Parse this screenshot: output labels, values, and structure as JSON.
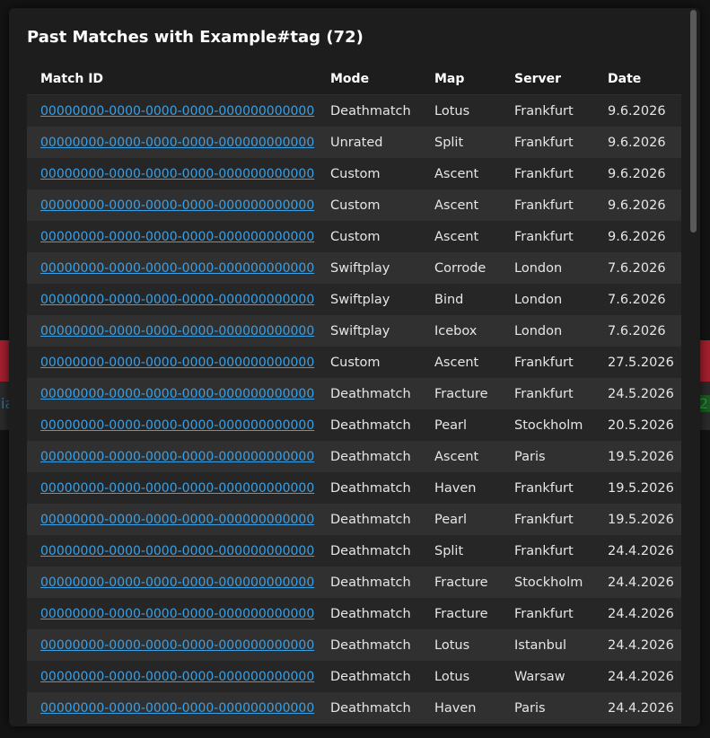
{
  "modal": {
    "title": "Past Matches with Example#tag (72)"
  },
  "table": {
    "headers": {
      "match_id": "Match ID",
      "mode": "Mode",
      "map": "Map",
      "server": "Server",
      "date": "Date"
    },
    "rows": [
      {
        "id": "00000000-0000-0000-0000-000000000000",
        "mode": "Deathmatch",
        "map": "Lotus",
        "server": "Frankfurt",
        "date": "9.6.2026"
      },
      {
        "id": "00000000-0000-0000-0000-000000000000",
        "mode": "Unrated",
        "map": "Split",
        "server": "Frankfurt",
        "date": "9.6.2026"
      },
      {
        "id": "00000000-0000-0000-0000-000000000000",
        "mode": "Custom",
        "map": "Ascent",
        "server": "Frankfurt",
        "date": "9.6.2026"
      },
      {
        "id": "00000000-0000-0000-0000-000000000000",
        "mode": "Custom",
        "map": "Ascent",
        "server": "Frankfurt",
        "date": "9.6.2026"
      },
      {
        "id": "00000000-0000-0000-0000-000000000000",
        "mode": "Custom",
        "map": "Ascent",
        "server": "Frankfurt",
        "date": "9.6.2026"
      },
      {
        "id": "00000000-0000-0000-0000-000000000000",
        "mode": "Swiftplay",
        "map": "Corrode",
        "server": "London",
        "date": "7.6.2026"
      },
      {
        "id": "00000000-0000-0000-0000-000000000000",
        "mode": "Swiftplay",
        "map": "Bind",
        "server": "London",
        "date": "7.6.2026"
      },
      {
        "id": "00000000-0000-0000-0000-000000000000",
        "mode": "Swiftplay",
        "map": "Icebox",
        "server": "London",
        "date": "7.6.2026"
      },
      {
        "id": "00000000-0000-0000-0000-000000000000",
        "mode": "Custom",
        "map": "Ascent",
        "server": "Frankfurt",
        "date": "27.5.2026"
      },
      {
        "id": "00000000-0000-0000-0000-000000000000",
        "mode": "Deathmatch",
        "map": "Fracture",
        "server": "Frankfurt",
        "date": "24.5.2026"
      },
      {
        "id": "00000000-0000-0000-0000-000000000000",
        "mode": "Deathmatch",
        "map": "Pearl",
        "server": "Stockholm",
        "date": "20.5.2026"
      },
      {
        "id": "00000000-0000-0000-0000-000000000000",
        "mode": "Deathmatch",
        "map": "Ascent",
        "server": "Paris",
        "date": "19.5.2026"
      },
      {
        "id": "00000000-0000-0000-0000-000000000000",
        "mode": "Deathmatch",
        "map": "Haven",
        "server": "Frankfurt",
        "date": "19.5.2026"
      },
      {
        "id": "00000000-0000-0000-0000-000000000000",
        "mode": "Deathmatch",
        "map": "Pearl",
        "server": "Frankfurt",
        "date": "19.5.2026"
      },
      {
        "id": "00000000-0000-0000-0000-000000000000",
        "mode": "Deathmatch",
        "map": "Split",
        "server": "Frankfurt",
        "date": "24.4.2026"
      },
      {
        "id": "00000000-0000-0000-0000-000000000000",
        "mode": "Deathmatch",
        "map": "Fracture",
        "server": "Stockholm",
        "date": "24.4.2026"
      },
      {
        "id": "00000000-0000-0000-0000-000000000000",
        "mode": "Deathmatch",
        "map": "Fracture",
        "server": "Frankfurt",
        "date": "24.4.2026"
      },
      {
        "id": "00000000-0000-0000-0000-000000000000",
        "mode": "Deathmatch",
        "map": "Lotus",
        "server": "Istanbul",
        "date": "24.4.2026"
      },
      {
        "id": "00000000-0000-0000-0000-000000000000",
        "mode": "Deathmatch",
        "map": "Lotus",
        "server": "Warsaw",
        "date": "24.4.2026"
      },
      {
        "id": "00000000-0000-0000-0000-000000000000",
        "mode": "Deathmatch",
        "map": "Haven",
        "server": "Paris",
        "date": "24.4.2026"
      }
    ]
  },
  "background": {
    "left_fragment": "ia",
    "right_fragment": "2"
  },
  "colors": {
    "link": "#3aa0e6",
    "modal_bg": "#1d1d1d",
    "row_odd": "#262626",
    "row_even": "#303030",
    "bg_accent_red": "#a8202f"
  }
}
